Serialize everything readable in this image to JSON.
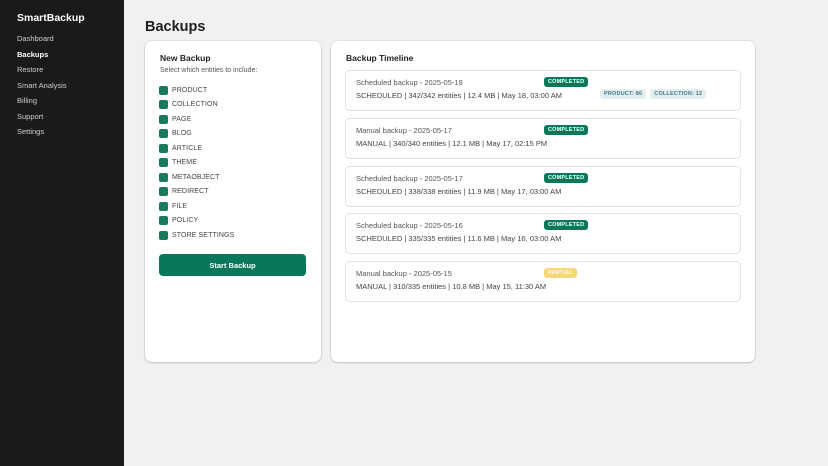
{
  "app": {
    "brand": "SmartBackup"
  },
  "sidebar": {
    "items": [
      {
        "label": "Dashboard",
        "active": false
      },
      {
        "label": "Backups",
        "active": true
      },
      {
        "label": "Restore",
        "active": false
      },
      {
        "label": "Smart Analysis",
        "active": false
      },
      {
        "label": "Billing",
        "active": false
      },
      {
        "label": "Support",
        "active": false
      },
      {
        "label": "Settings",
        "active": false
      }
    ]
  },
  "page": {
    "title": "Backups"
  },
  "new_backup": {
    "title": "New Backup",
    "subtitle": "Select which entities to include:",
    "entities": [
      {
        "label": "PRODUCT",
        "checked": true
      },
      {
        "label": "COLLECTION",
        "checked": true
      },
      {
        "label": "PAGE",
        "checked": true
      },
      {
        "label": "BLOG",
        "checked": true
      },
      {
        "label": "ARTICLE",
        "checked": true
      },
      {
        "label": "THEME",
        "checked": true
      },
      {
        "label": "METAOBJECT",
        "checked": true
      },
      {
        "label": "REDIRECT",
        "checked": true
      },
      {
        "label": "FILE",
        "checked": true
      },
      {
        "label": "POLICY",
        "checked": true
      },
      {
        "label": "STORE SETTINGS",
        "checked": true
      }
    ],
    "start_label": "Start Backup",
    "accent_color": "#08775a"
  },
  "timeline": {
    "title": "Backup Timeline",
    "items": [
      {
        "title": "Scheduled backup - 2025-05-18",
        "meta": "SCHEDULED | 342/342 entities | 12.4 MB | May 18, 03:00 AM",
        "status": "COMPLETED",
        "status_kind": "completed",
        "chips": [
          "PRODUCT: 86",
          "COLLECTION: 12"
        ]
      },
      {
        "title": "Manual backup - 2025-05-17",
        "meta": "MANUAL | 340/340 entities | 12.1 MB | May 17, 02:15 PM",
        "status": "COMPLETED",
        "status_kind": "completed",
        "chips": []
      },
      {
        "title": "Scheduled backup - 2025-05-17",
        "meta": "SCHEDULED | 338/338 entities | 11.9 MB | May 17, 03:00 AM",
        "status": "COMPLETED",
        "status_kind": "completed",
        "chips": []
      },
      {
        "title": "Scheduled backup - 2025-05-16",
        "meta": "SCHEDULED | 335/335 entities | 11.6 MB | May 16, 03:00 AM",
        "status": "COMPLETED",
        "status_kind": "completed",
        "chips": []
      },
      {
        "title": "Manual backup - 2025-05-15",
        "meta": "MANUAL | 310/335 entities | 10.8 MB | May 15, 11:30 AM",
        "status": "PARTIAL",
        "status_kind": "partial",
        "chips": []
      }
    ]
  }
}
